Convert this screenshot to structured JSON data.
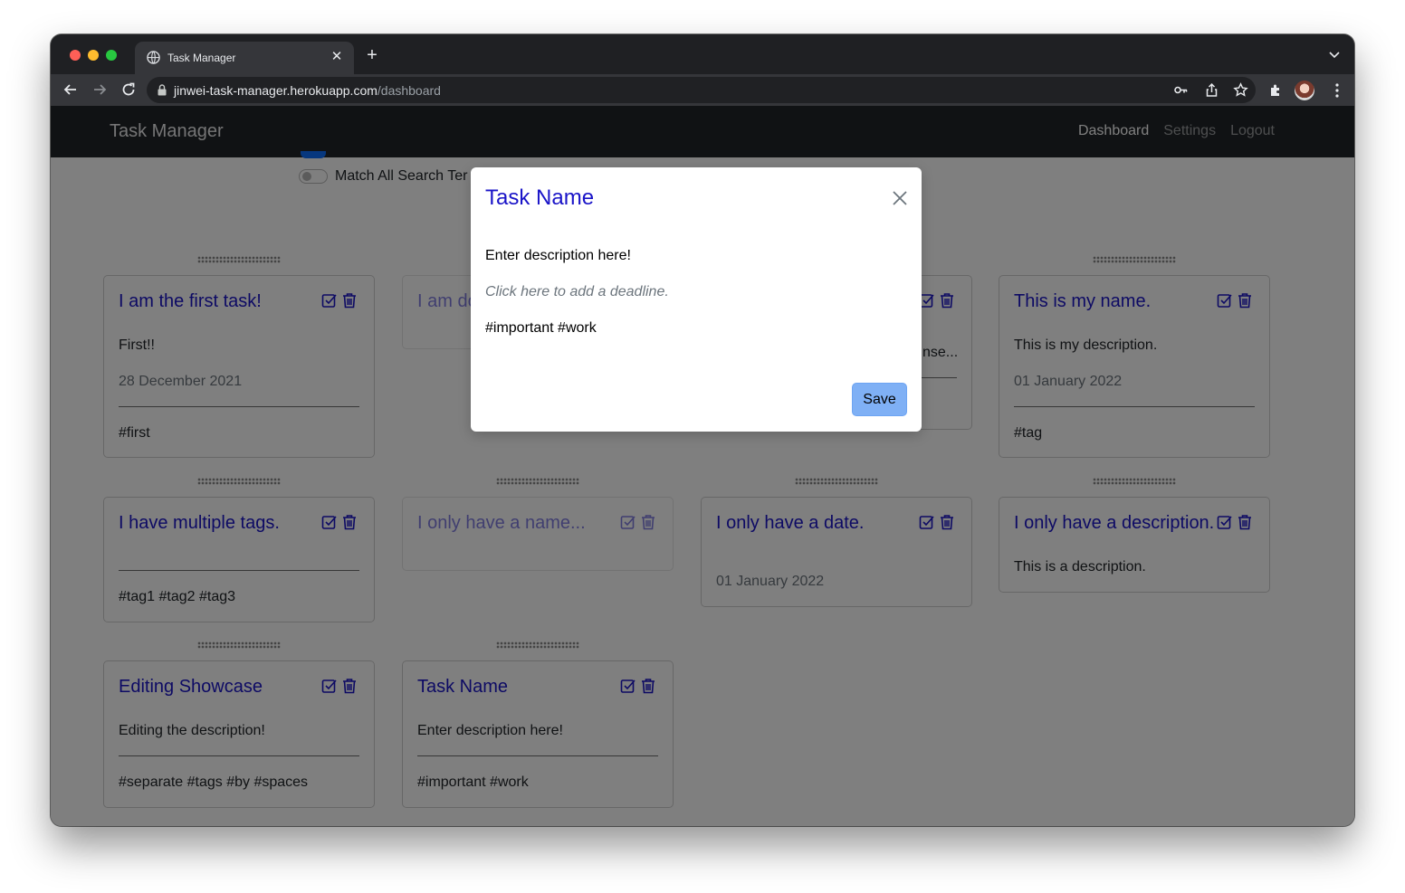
{
  "browser": {
    "tab_title": "Task Manager",
    "url_host": "jinwei-task-manager.herokuapp.com",
    "url_path": "/dashboard"
  },
  "navbar": {
    "brand": "Task Manager",
    "links": [
      "Dashboard",
      "Settings",
      "Logout"
    ],
    "active_link": "Dashboard"
  },
  "search": {
    "match_all_label": "Match All Search Ter"
  },
  "cards": [
    {
      "title": "I am the first task!",
      "description": "First!!",
      "date": "28 December 2021",
      "tags": "#first"
    },
    {
      "title": "I am do",
      "faded": true
    },
    {
      "description": "nse..."
    },
    {
      "title": "This is my name.",
      "description": "This is my description.",
      "date": "01 January 2022",
      "tags": "#tag"
    },
    {
      "title": "I have multiple tags.",
      "tags": "#tag1 #tag2 #tag3"
    },
    {
      "title": "I only have a name...",
      "faded": true
    },
    {
      "title": "I only have a date.",
      "date": "01 January 2022"
    },
    {
      "title": "I only have a description.",
      "description": "This is a description."
    },
    {
      "title": "Editing Showcase",
      "description": "Editing the description!",
      "tags": "#separate #tags #by #spaces"
    },
    {
      "title": "Task Name",
      "description": "Enter description here!",
      "tags": "#important #work"
    }
  ],
  "modal": {
    "title": "Task Name",
    "description": "Enter description here!",
    "deadline_placeholder": "Click here to add a deadline.",
    "tags": "#important #work",
    "save_label": "Save"
  },
  "colors": {
    "accent_title": "#1a14c8",
    "navbar_bg": "#212529",
    "save_button": "#7fb0f5",
    "muted_text": "#6c757d"
  },
  "icons": {
    "card_complete": "check-square-icon",
    "card_delete": "trash-icon",
    "modal_close": "close-icon",
    "drag_handle": "drag-handle-icon"
  }
}
